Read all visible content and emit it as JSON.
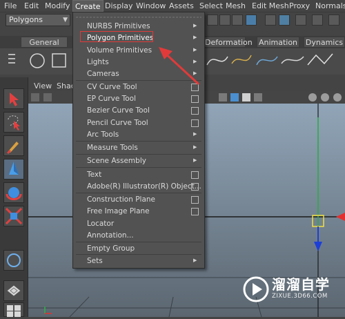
{
  "menubar": {
    "items": [
      "File",
      "Edit",
      "Modify",
      "Create",
      "Display",
      "Window",
      "Assets",
      "Select",
      "Mesh",
      "Edit Mesh",
      "Proxy",
      "Normals"
    ],
    "active": "Create"
  },
  "status_line": {
    "mode": "Polygons"
  },
  "shelf": {
    "tabs": [
      "General",
      "Deformation",
      "Animation",
      "Dynamics"
    ]
  },
  "panel": {
    "menu": [
      "View",
      "Shac"
    ]
  },
  "create_menu": {
    "items": [
      {
        "label": "NURBS Primitives",
        "type": "submenu"
      },
      {
        "label": "Polygon Primitives",
        "type": "submenu",
        "highlighted": true
      },
      {
        "label": "Volume Primitives",
        "type": "submenu"
      },
      {
        "label": "Lights",
        "type": "submenu"
      },
      {
        "label": "Cameras",
        "type": "submenu"
      },
      {
        "label": "CV Curve Tool",
        "type": "option"
      },
      {
        "label": "EP Curve Tool",
        "type": "option"
      },
      {
        "label": "Bezier Curve Tool",
        "type": "option"
      },
      {
        "label": "Pencil Curve Tool",
        "type": "option"
      },
      {
        "label": "Arc Tools",
        "type": "submenu"
      },
      {
        "label": "Measure Tools",
        "type": "submenu"
      },
      {
        "label": "Scene Assembly",
        "type": "submenu"
      },
      {
        "label": "Text",
        "type": "option"
      },
      {
        "label": "Adobe(R) Illustrator(R) Object...",
        "type": "option"
      },
      {
        "label": "Construction Plane",
        "type": "option"
      },
      {
        "label": "Free Image Plane",
        "type": "option"
      },
      {
        "label": "Locator",
        "type": "plain"
      },
      {
        "label": "Annotation...",
        "type": "plain"
      },
      {
        "label": "Empty Group",
        "type": "plain"
      },
      {
        "label": "Sets",
        "type": "submenu"
      }
    ]
  },
  "annotation": {
    "color": "#e23a3a"
  },
  "watermark": {
    "title": "溜溜自学",
    "subtitle": "ZIXUE.3D66.COM"
  }
}
